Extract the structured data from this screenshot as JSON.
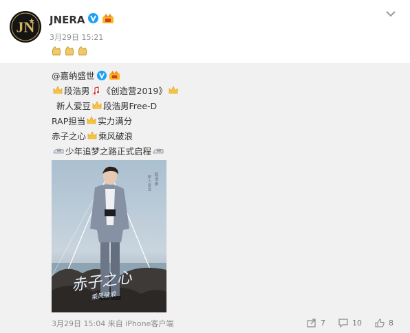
{
  "post": {
    "username": "JNERA",
    "timestamp": "3月29日 15:21",
    "avatar_text": "JN",
    "icons": {
      "verified": "verified-v-icon",
      "vip": "vip-crown-icon",
      "menu": "chevron-down-icon",
      "lucky": "lucky-charm-icon"
    }
  },
  "repost": {
    "original_author": "@嘉纳盛世",
    "lines": {
      "line1_name": "段浩男",
      "line1_show": "《创造营2019》",
      "line2_a": "新人爱豆",
      "line2_b": "段浩男Free-D",
      "line3_a": "RAP担当",
      "line3_b": "实力满分",
      "line4_a": "赤子之心",
      "line4_b": "乘风破浪",
      "line5": "少年追梦之路正式启程"
    },
    "poster": {
      "name_vertical": "段浩男",
      "small_caption": "新人爱豆",
      "calligraphy": "赤子之心"
    },
    "meta": "3月29日 15:04 来自 iPhone客户端",
    "actions": {
      "forward_count": "7",
      "comment_count": "10",
      "like_count": "8"
    }
  },
  "colors": {
    "verified_blue": "#1aa0f5",
    "repost_bg": "#f1f1f1",
    "crown_gold": "#f5c542"
  }
}
